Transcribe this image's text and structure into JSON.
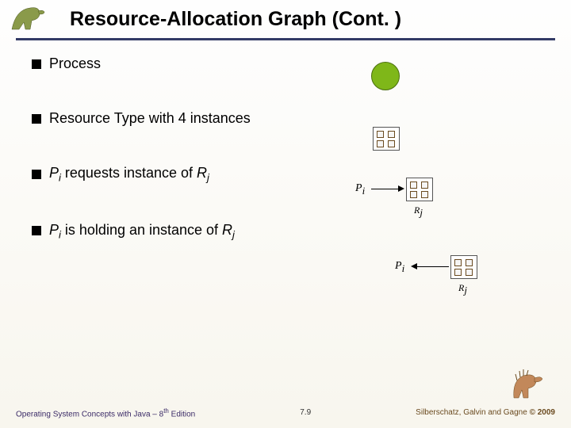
{
  "title": "Resource-Allocation Graph (Cont. )",
  "bullets": {
    "b1": "Process",
    "b2": "Resource Type with 4 instances",
    "b3_pre": "P",
    "b3_sub1": "i",
    "b3_mid": " requests instance of ",
    "b3_r": "R",
    "b3_sub2": "j",
    "b4_pre": "P",
    "b4_sub1": "i",
    "b4_mid": " is holding an instance of ",
    "b4_r": "R",
    "b4_sub2": "j"
  },
  "labels": {
    "Pi": "P",
    "Pi_sub": "i",
    "Rj": "R",
    "Rj_sub": "j"
  },
  "footer": {
    "left_pre": "Operating System Concepts with Java – 8",
    "left_sup": "th",
    "left_post": " Edition",
    "center": "7.9",
    "right_pre": "Silberschatz, Galvin and Gagne ",
    "right_post": "© 2009"
  }
}
